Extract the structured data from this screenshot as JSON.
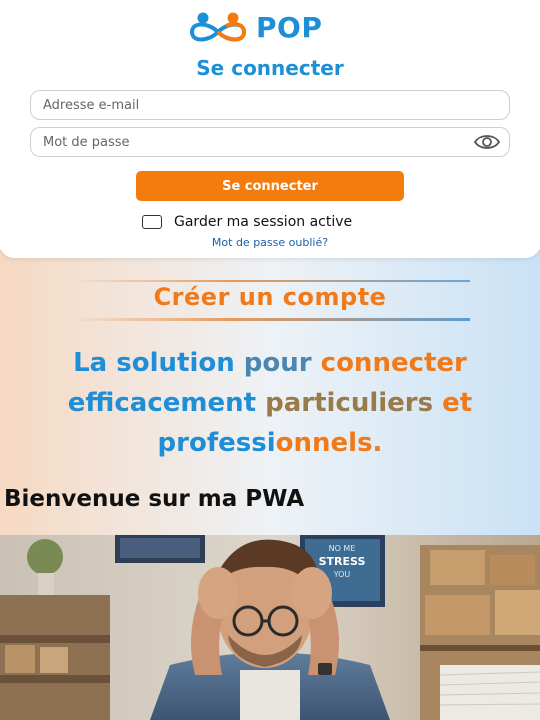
{
  "brand": {
    "name": "POP",
    "logo_icon": "two-people-infinity-icon",
    "colors": {
      "blue": "#1c8fd6",
      "orange": "#f47b0e"
    }
  },
  "login": {
    "title": "Se connecter",
    "email_placeholder": "Adresse e-mail",
    "email_value": "",
    "password_placeholder": "Mot de passe",
    "password_value": "",
    "password_toggle_icon": "eye-icon",
    "submit_label": "Se connecter",
    "remember_label": "Garder ma session active",
    "remember_checked": false,
    "forgot_label": "Mot de passe oublié?"
  },
  "promo": {
    "create_account_label": "Créer un compte",
    "tagline_parts": [
      {
        "text": "La solution ",
        "color": "blue"
      },
      {
        "text": "pour ",
        "color": "steel"
      },
      {
        "text": "connecter",
        "color": "orange"
      },
      {
        "text": "efficacement ",
        "color": "blue"
      },
      {
        "text": "particuliers ",
        "color": "olive"
      },
      {
        "text": "et",
        "color": "orange"
      },
      {
        "text": "professi",
        "color": "blue"
      },
      {
        "text": "onnels.",
        "color": "orange"
      }
    ],
    "welcome": "Bienvenue sur ma PWA"
  },
  "photo": {
    "poster_line1": "NO ME",
    "poster_line2": "STRESS",
    "poster_line3": "YOU"
  }
}
